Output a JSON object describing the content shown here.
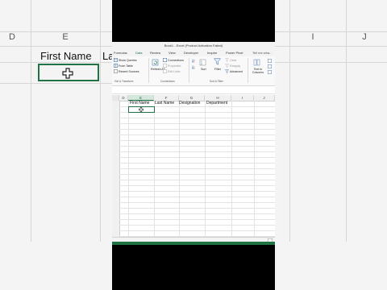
{
  "window": {
    "title": "Book1 - Excel (Product Activation Failed)"
  },
  "ribbon_tabs": [
    {
      "label": "Formulas"
    },
    {
      "label": "Data"
    },
    {
      "label": "Review"
    },
    {
      "label": "View"
    },
    {
      "label": "Developer"
    },
    {
      "label": "Inquire"
    },
    {
      "label": "Power Pivot"
    }
  ],
  "tell_me": "Tell me wha...",
  "ribbon": {
    "get_transform": {
      "items": [
        "Show Queries",
        "From Table",
        "Recent Sources"
      ],
      "label": "Get & Transform"
    },
    "connections": {
      "refresh_label": "Refresh All",
      "items": [
        "Connections",
        "Properties",
        "Edit Links"
      ],
      "label": "Connections"
    },
    "sort_filter": {
      "sort_label": "Sort",
      "filter_label": "Filter",
      "items": [
        "Clear",
        "Reapply",
        "Advanced"
      ],
      "label": "Sort & Filter"
    },
    "data_tools": {
      "text_to_columns": "Text to Columns"
    }
  },
  "columns": [
    "D",
    "E",
    "F",
    "G",
    "H",
    "I",
    "J"
  ],
  "selected_column": "E",
  "headers_row": {
    "E": "First Name",
    "F": "Last Name",
    "G": "Designation",
    "H": "Department"
  },
  "zoom_bg": {
    "left_columns": [
      "D",
      "E"
    ],
    "right_columns": [
      "I",
      "J"
    ],
    "first_name": "First Name",
    "last_name_fragment": "La"
  },
  "colors": {
    "excel_green": "#217346"
  },
  "icons": [
    "table-icon",
    "refresh-icon",
    "sort-icon",
    "filter-icon",
    "cross-cursor-icon"
  ]
}
